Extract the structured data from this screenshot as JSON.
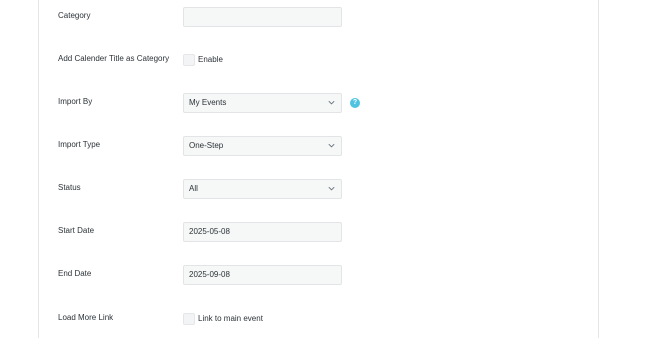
{
  "form": {
    "category": {
      "label": "Category",
      "value": ""
    },
    "add_title": {
      "label": "Add Calender Title as Category",
      "checkbox_label": "Enable"
    },
    "import_by": {
      "label": "Import By",
      "value": "My Events",
      "help_icon": "question-circle-icon"
    },
    "import_type": {
      "label": "Import Type",
      "value": "One-Step"
    },
    "status": {
      "label": "Status",
      "value": "All"
    },
    "start_date": {
      "label": "Start Date",
      "value": "2025-05-08"
    },
    "end_date": {
      "label": "End Date",
      "value": "2025-09-08"
    },
    "load_more": {
      "label": "Load More Link",
      "checkbox_label": "Link to main event"
    }
  },
  "colors": {
    "help_icon": "#4fc3e0",
    "field_bg": "#f6f7f7",
    "border": "#e2e4e7"
  }
}
